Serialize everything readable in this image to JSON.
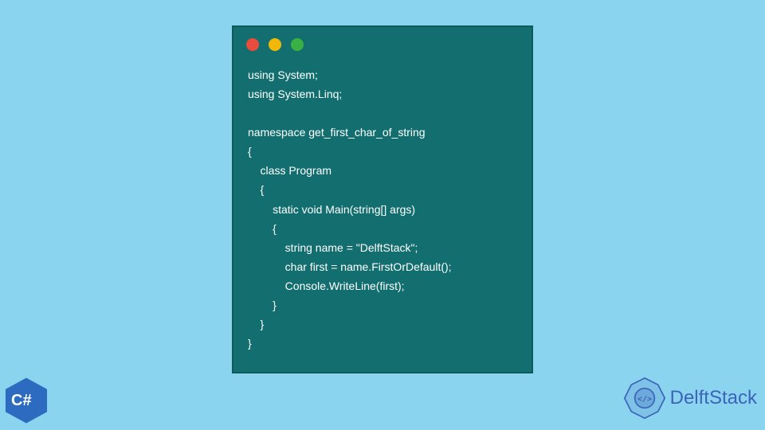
{
  "code": {
    "lines": [
      "using System;",
      "using System.Linq;",
      "",
      "namespace get_first_char_of_string",
      "{",
      "    class Program",
      "    {",
      "        static void Main(string[] args)",
      "        {",
      "            string name = \"DelftStack\";",
      "            char first = name.FirstOrDefault();",
      "            Console.WriteLine(first);",
      "        }",
      "    }",
      "}"
    ]
  },
  "badge": {
    "label": "C#"
  },
  "brand": {
    "name": "DelftStack"
  },
  "colors": {
    "page_bg": "#8bd4f0",
    "window_bg": "#136f6f",
    "csharp_hex": "#2c6bbf",
    "brand_accent": "#3b64b8"
  }
}
